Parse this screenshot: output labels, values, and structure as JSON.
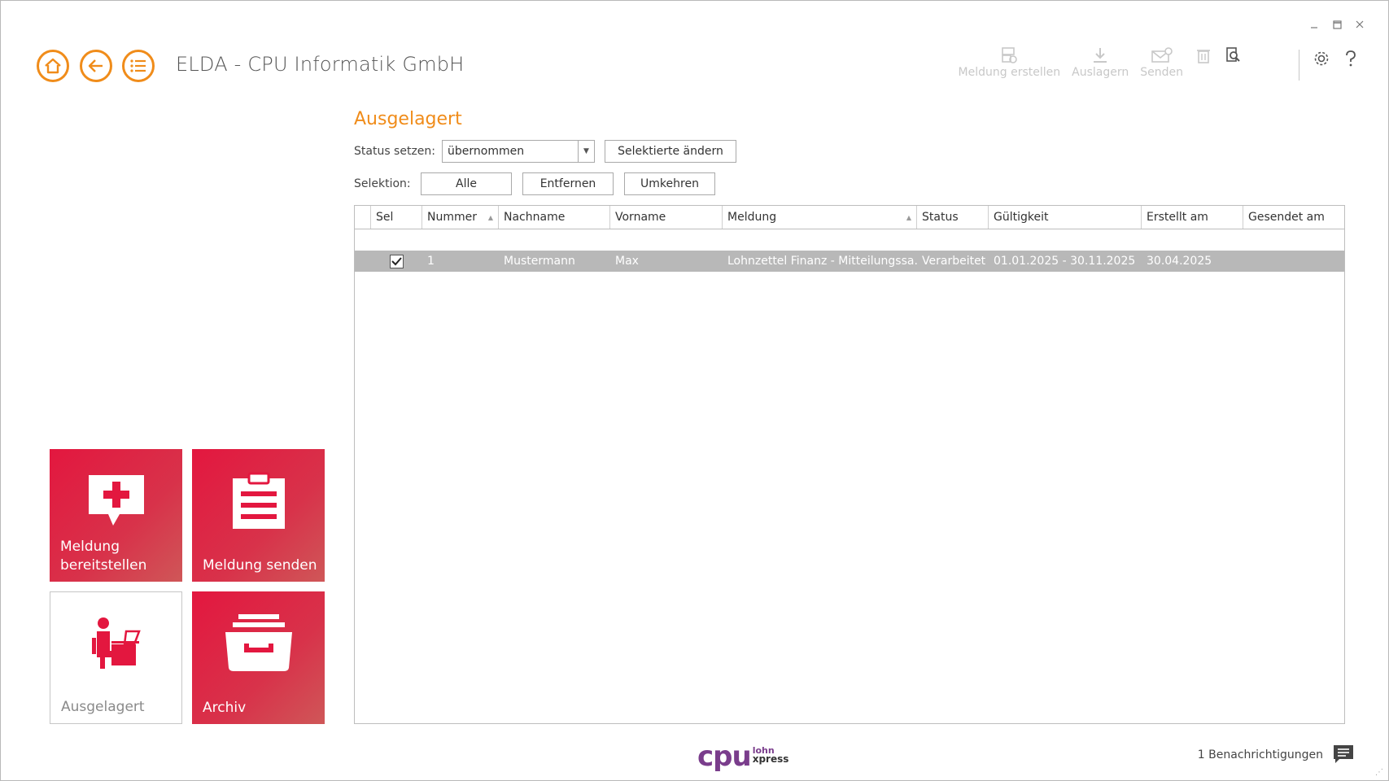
{
  "window": {
    "title": "ELDA - CPU Informatik GmbH"
  },
  "toolbar": {
    "create_label": "Meldung erstellen",
    "export_label": "Auslagern",
    "send_label": "Senden"
  },
  "section": {
    "title": "Ausgelagert"
  },
  "status": {
    "label": "Status setzen:",
    "value": "übernommen",
    "apply_button": "Selektierte ändern"
  },
  "selection": {
    "label": "Selektion:",
    "all_button": "Alle",
    "remove_button": "Entfernen",
    "invert_button": "Umkehren"
  },
  "grid": {
    "columns": [
      "Sel",
      "Nummer",
      "Nachname",
      "Vorname",
      "Meldung",
      "Status",
      "Gültigkeit",
      "Erstellt am",
      "Gesendet am"
    ],
    "rows": [
      {
        "selected": true,
        "nummer": "1",
        "nachname": "Mustermann",
        "vorname": "Max",
        "meldung": "Lohnzettel Finanz - Mitteilungssa...",
        "status": "Verarbeitet",
        "gueltigkeit": "01.01.2025 - 30.11.2025",
        "erstellt": "30.04.2025",
        "gesendet": ""
      }
    ]
  },
  "tiles": {
    "provide": "Meldung bereitstellen",
    "provide_line1": "Meldung",
    "provide_line2": "bereitstellen",
    "send": "Meldung senden",
    "exported": "Ausgelagert",
    "archive": "Archiv"
  },
  "footer": {
    "logo_main": "cpu",
    "logo_sub1": "lohn",
    "logo_sub2": "xpress",
    "notifications": "1 Benachrichtigungen"
  },
  "colors": {
    "accent": "#f08c1a",
    "tile_red": "#e3173f",
    "logo_purple": "#7a3d8c",
    "row_selected": "#b8b8b8"
  }
}
